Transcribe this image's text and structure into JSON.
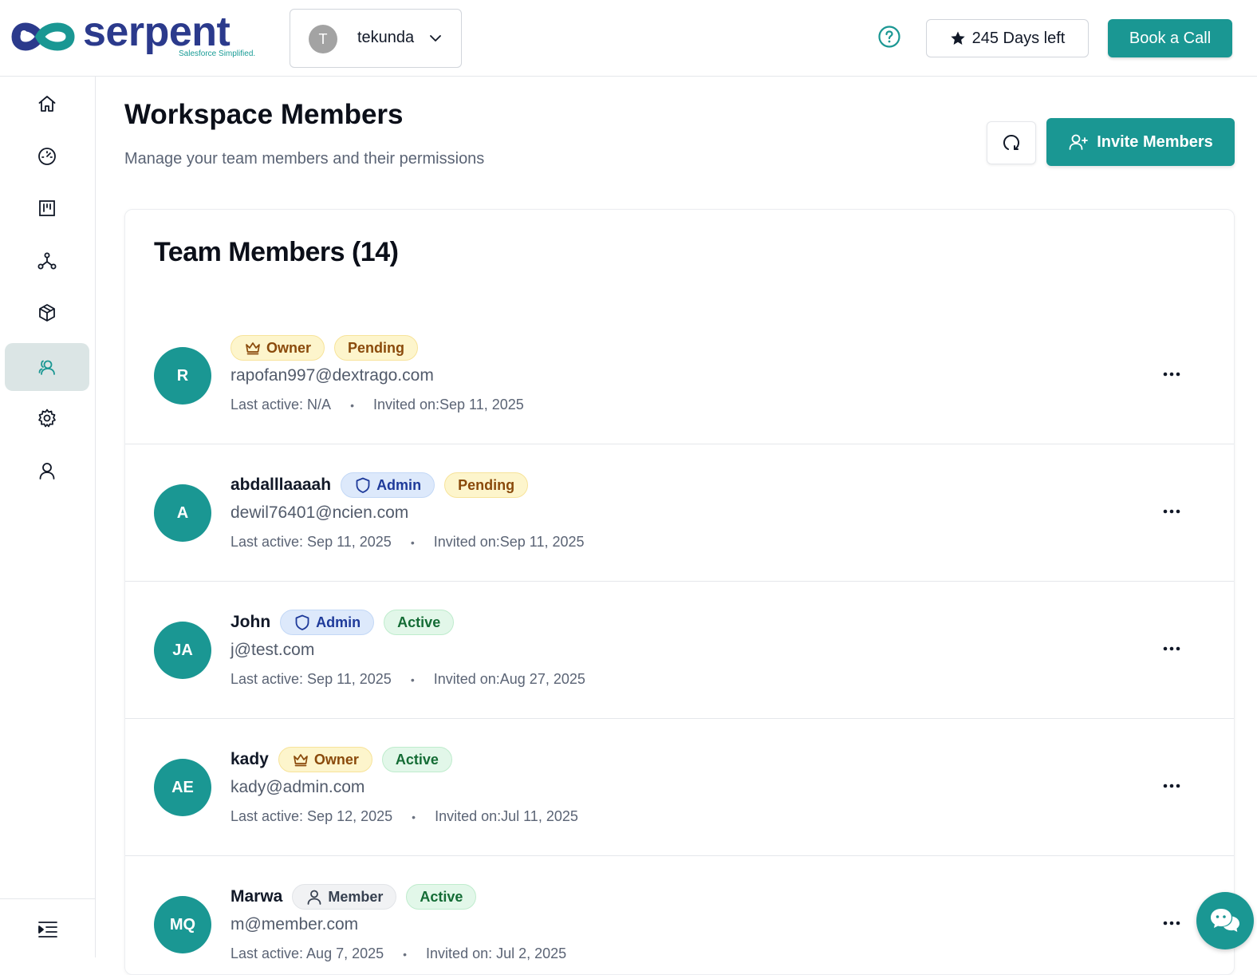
{
  "header": {
    "logo_text": "serpent",
    "logo_tagline": "Salesforce Simplified.",
    "workspace": {
      "initial": "T",
      "name": "tekunda"
    },
    "days_left": "245 Days left",
    "book_call": "Book a Call"
  },
  "sidebar": {
    "items": [
      {
        "icon": "home-icon"
      },
      {
        "icon": "dashboard-gauge-icon"
      },
      {
        "icon": "kanban-board-icon"
      },
      {
        "icon": "network-icon"
      },
      {
        "icon": "package-cube-icon"
      },
      {
        "icon": "users-icon",
        "active": true
      },
      {
        "icon": "gear-icon"
      },
      {
        "icon": "user-icon"
      }
    ]
  },
  "page": {
    "title": "Workspace Members",
    "subtitle": "Manage your team members and their permissions",
    "invite_label": "Invite Members"
  },
  "card": {
    "title": "Team Members (14)"
  },
  "members": [
    {
      "initials": "R",
      "name": "",
      "email": "rapofan997@dextrago.com",
      "role": "Owner",
      "status": "Pending",
      "last_active": "Last active: N/A",
      "invited": "Invited on:Sep 11, 2025"
    },
    {
      "initials": "A",
      "name": "abdalllaaaah",
      "email": "dewil76401@ncien.com",
      "role": "Admin",
      "status": "Pending",
      "last_active": "Last active: Sep 11, 2025",
      "invited": "Invited on:Sep 11, 2025"
    },
    {
      "initials": "JA",
      "name": "John",
      "email": "j@test.com",
      "role": "Admin",
      "status": "Active",
      "last_active": "Last active: Sep 11, 2025",
      "invited": "Invited on:Aug 27, 2025"
    },
    {
      "initials": "AE",
      "name": "kady",
      "email": "kady@admin.com",
      "role": "Owner",
      "status": "Active",
      "last_active": "Last active: Sep 12, 2025",
      "invited": "Invited on:Jul 11, 2025"
    },
    {
      "initials": "MQ",
      "name": "Marwa",
      "email": "m@member.com",
      "role": "Member",
      "status": "Active",
      "last_active": "Last active: Aug 7, 2025",
      "invited": "Invited on: Jul 2, 2025"
    }
  ],
  "meta_separator": "•",
  "colors": {
    "brand_teal": "#1a9793",
    "logo_navy": "#2b3a8c"
  }
}
